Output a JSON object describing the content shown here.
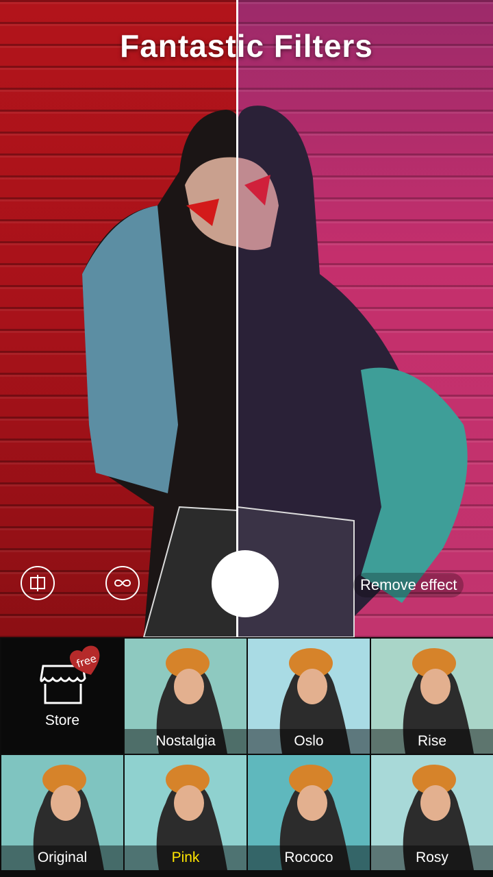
{
  "header": {
    "title": "Fantastic Filters"
  },
  "controls": {
    "compare_icon": "compare-split-icon",
    "loop_icon": "infinity-loop-icon",
    "remove_effect_label": "Remove effect"
  },
  "store": {
    "label": "Store",
    "badge": "free",
    "icon": "store-awning-icon"
  },
  "filters": [
    {
      "name": "Nostalgia",
      "bg": "#8ec9c0",
      "selected": false
    },
    {
      "name": "Oslo",
      "bg": "#a9dbe4",
      "selected": false
    },
    {
      "name": "Rise",
      "bg": "#a9d5c8",
      "selected": false
    },
    {
      "name": "Original",
      "bg": "#7fc4c0",
      "selected": false
    },
    {
      "name": "Pink",
      "bg": "#8fd1cf",
      "selected": true
    },
    {
      "name": "Rococo",
      "bg": "#5fb8bd",
      "selected": false
    },
    {
      "name": "Rosy",
      "bg": "#a8d9d8",
      "selected": false
    }
  ],
  "colors": {
    "selected_label": "#ffe500",
    "badge": "#b52a2a"
  }
}
